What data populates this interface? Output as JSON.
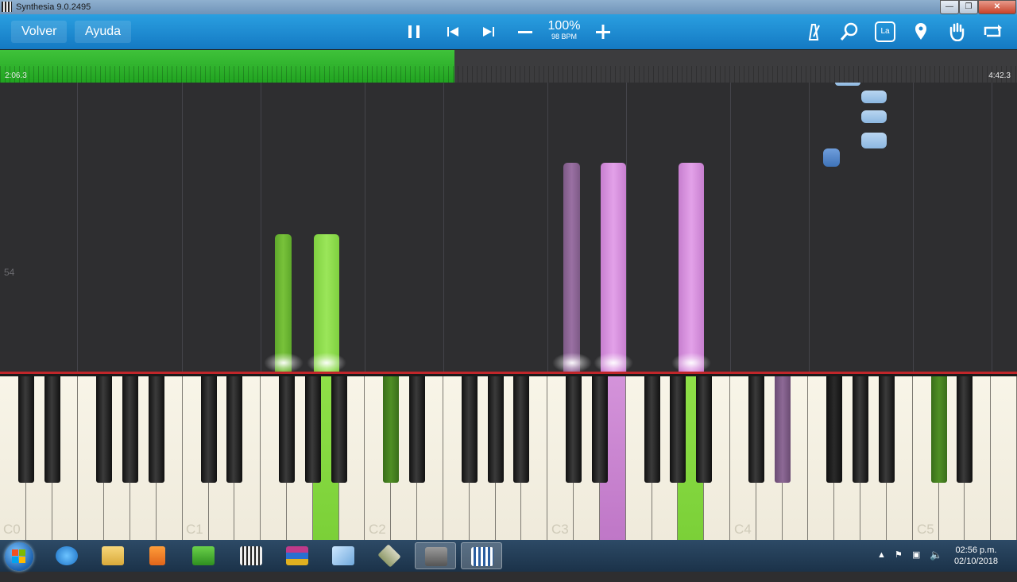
{
  "window": {
    "title": "Synthesia 9.0.2495",
    "controls": [
      "minimize",
      "maximize",
      "close"
    ]
  },
  "toolbar": {
    "back_label": "Volver",
    "help_label": "Ayuda",
    "speed_percent": "100%",
    "tempo": "98 BPM",
    "icons": [
      "pause-icon",
      "skip-back-icon",
      "skip-forward-icon",
      "minus-icon",
      "plus-icon",
      "metronome-icon",
      "zoom-icon",
      "note-labels-icon",
      "bookmark-icon",
      "hand-icon",
      "loop-icon"
    ],
    "note_labels_glyph": "La",
    "accent": "#1e8fd6"
  },
  "progress": {
    "elapsed": "2:06.3",
    "total": "4:42.3",
    "fraction": 0.447,
    "color": "#2fb52d"
  },
  "piano_roll": {
    "measure_number": "54",
    "note_colors": {
      "left_hand": "#8ad84b",
      "right_hand": "#d494dc",
      "upcoming": "#8cb7e1"
    }
  },
  "keyboard": {
    "octave_labels": [
      "C0",
      "C1",
      "C2",
      "C3",
      "C4",
      "C5"
    ],
    "highlight_line_color": "#c0262a"
  },
  "taskbar": {
    "apps": [
      "internet-explorer-icon",
      "file-explorer-icon",
      "media-player-icon",
      "zip-app-icon",
      "piano-app-icon",
      "winrar-icon",
      "document-app-icon",
      "xbox-app-icon",
      "recorder-app-icon",
      "synthesia-app-icon"
    ],
    "time": "02:56 p.m.",
    "date": "02/10/2018"
  }
}
